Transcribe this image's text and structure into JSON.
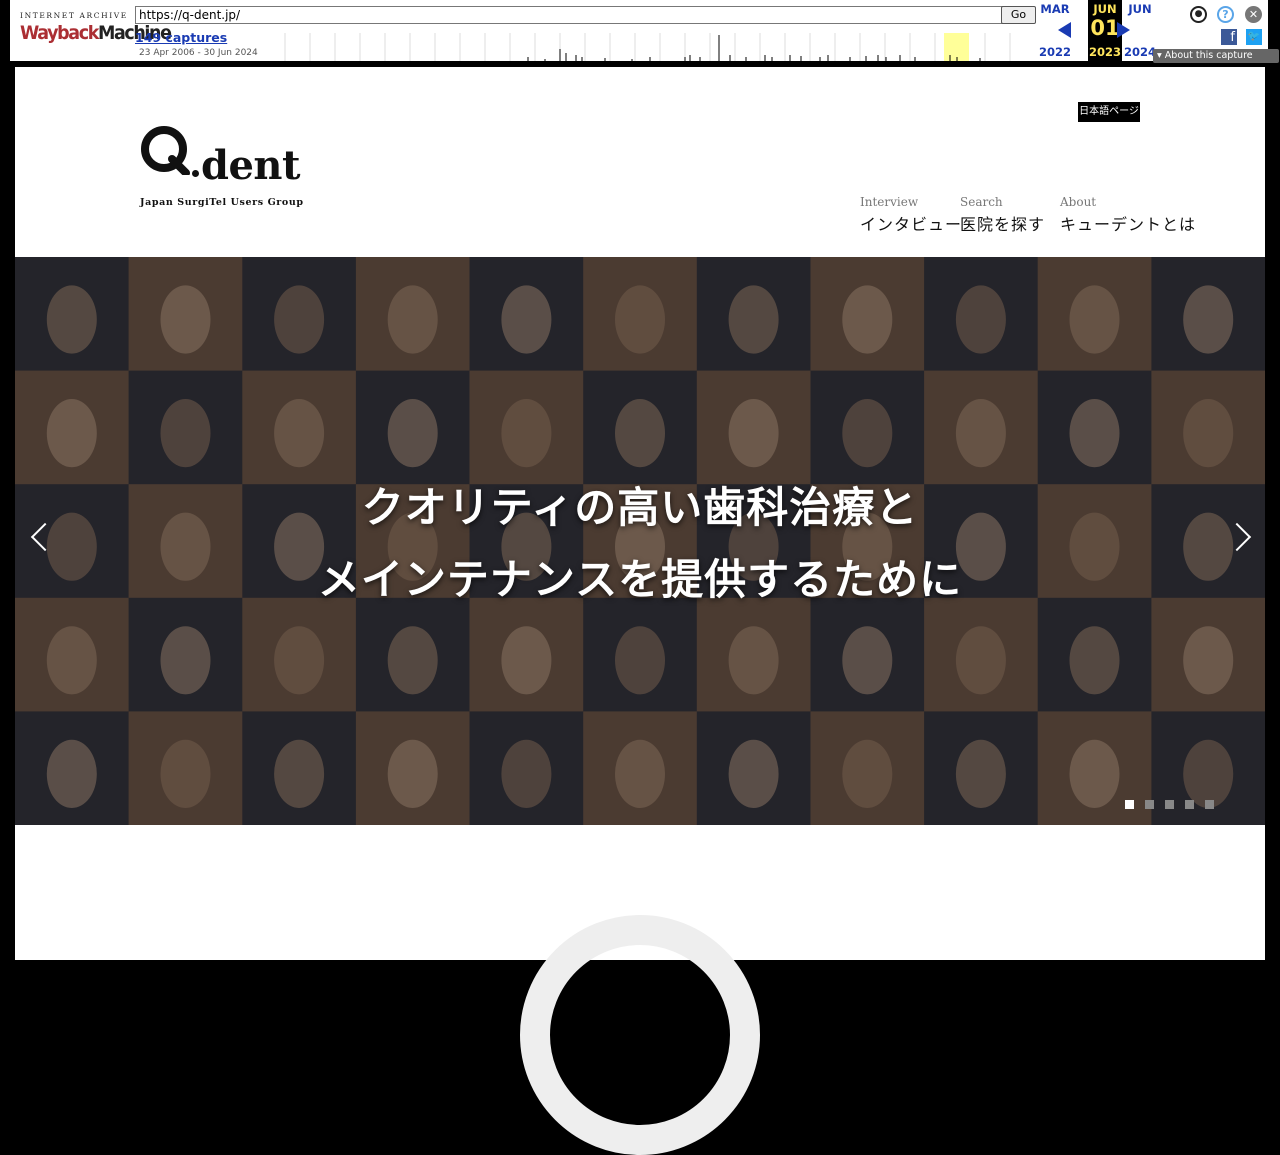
{
  "wayback": {
    "logo_top": "INTERNET ARCHIVE",
    "logo_way": "Wayback",
    "logo_machine": "Machine",
    "url": "https://q-dent.jp/",
    "go_label": "Go",
    "captures_label": "149 captures",
    "date_range": "23 Apr 2006 - 30 Jun 2024",
    "months": {
      "prev": {
        "month": "MAR",
        "year": "2022"
      },
      "current": {
        "month": "JUN",
        "day": "01",
        "year": "2023"
      },
      "next": {
        "month": "JUN",
        "year": "2024"
      }
    },
    "about_label": "About this capture",
    "colors": {
      "link": "#1a3bb3",
      "current_bg": "#000000",
      "current_text": "#ffe55c"
    }
  },
  "site": {
    "top_button": "日本語ページ",
    "logo_word": "dent",
    "logo_tagline": "Japan SurgiTel Users Group",
    "nav": [
      {
        "en": "Interview",
        "jp": "インタビュー"
      },
      {
        "en": "Search",
        "jp": "医院を探す"
      },
      {
        "en": "About",
        "jp": "キューデントとは"
      }
    ],
    "hero": {
      "line1": "クオリティの高い歯科治療と",
      "line2": "メインテナンスを提供するために",
      "slide_count": 5,
      "active_slide": 1
    }
  }
}
